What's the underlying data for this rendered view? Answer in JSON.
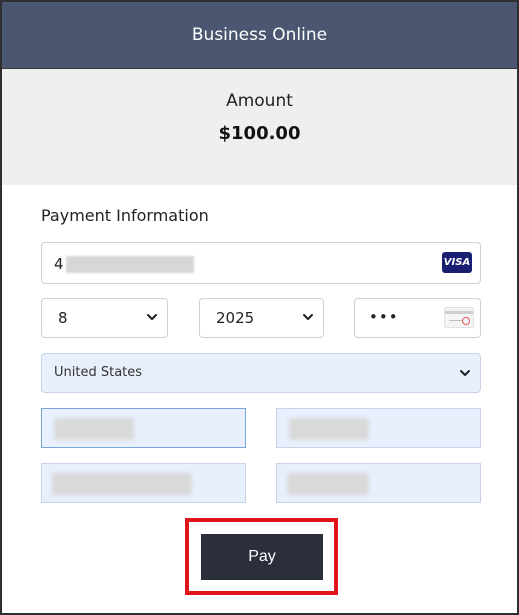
{
  "header": {
    "title": "Business Online"
  },
  "amount": {
    "label": "Amount",
    "value": "$100.00"
  },
  "payment": {
    "section_title": "Payment Information",
    "card_number_visible": "4",
    "card_brand": "VISA",
    "expiry_month": "8",
    "expiry_year": "2025",
    "cvv_masked": "•••",
    "country": "United States"
  },
  "actions": {
    "pay_label": "Pay"
  },
  "colors": {
    "header_bg": "#4b5670",
    "button_bg": "#2b2f3c",
    "highlight": "#e0141b",
    "autofill_bg": "#e8f0fe"
  },
  "icons": [
    "visa-logo-icon",
    "cvv-card-icon",
    "chevron-down-icon"
  ]
}
